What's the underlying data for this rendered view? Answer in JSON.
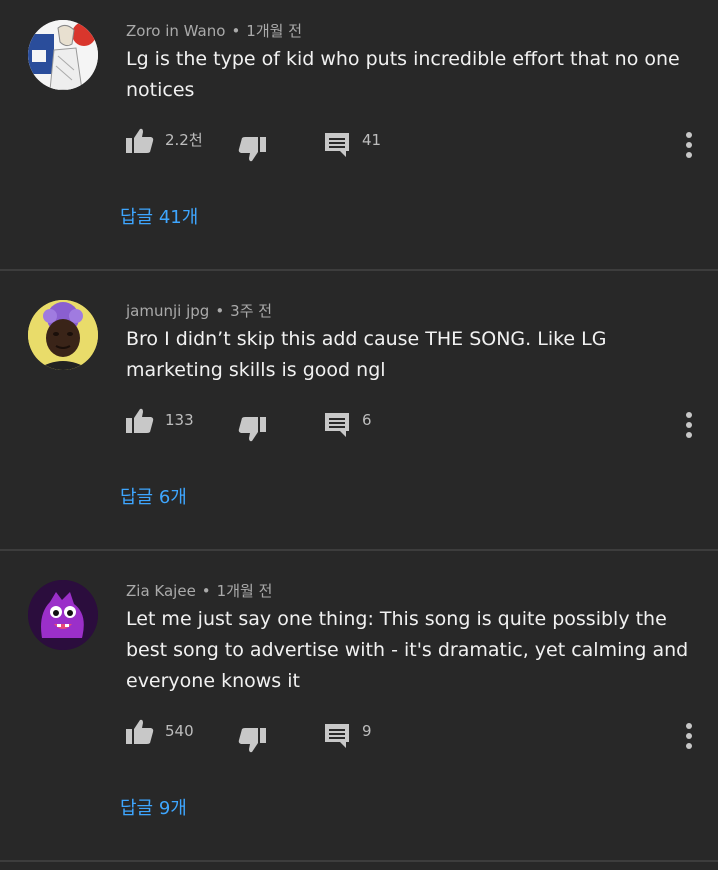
{
  "comments": [
    {
      "author": "Zoro in Wano",
      "separator": "•",
      "time": "1개월 전",
      "text": "Lg is the type of kid who puts incredible effort that no one notices",
      "likes": "2.2천",
      "reply_count": "41",
      "replies_label": "답글 41개",
      "avatar_icon": "anime-character-avatar"
    },
    {
      "author": "jamunji jpg",
      "separator": "•",
      "time": "3주 전",
      "text": "Bro I didn’t skip this add cause THE SONG. Like LG marketing skills is good ngl",
      "likes": "133",
      "reply_count": "6",
      "replies_label": "답글 6개",
      "avatar_icon": "person-photo-avatar"
    },
    {
      "author": "Zia Kajee",
      "separator": "•",
      "time": "1개월 전",
      "text": "Let me just say one thing: This song is quite possibly the best song to advertise with - it's dramatic, yet calming and everyone knows it",
      "likes": "540",
      "reply_count": "9",
      "replies_label": "답글 9개",
      "avatar_icon": "purple-monster-avatar"
    }
  ],
  "colors": {
    "background": "#282828",
    "text": "#f1f1f1",
    "meta": "#aaaaaa",
    "link": "#3ea6ff",
    "icon": "#c8c8c8"
  }
}
